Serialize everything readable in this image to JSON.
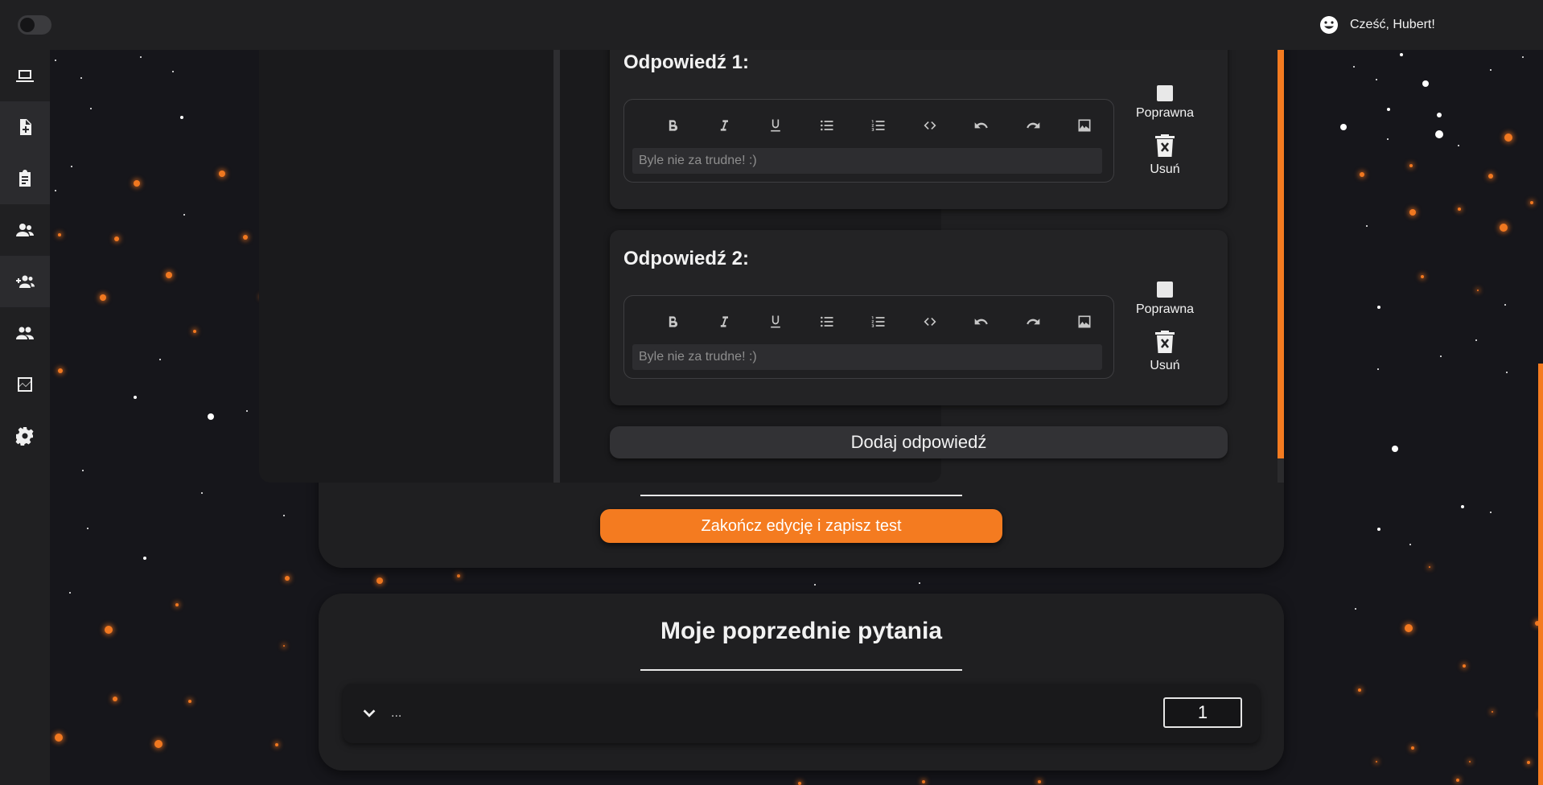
{
  "header": {
    "theme_toggle_icon": "toggle-switch",
    "user_icon": "smiley-face-icon",
    "greeting": "Cześć, Hubert!"
  },
  "sidebar": {
    "items": [
      {
        "icon": "laptop-icon"
      },
      {
        "icon": "add-document-icon"
      },
      {
        "icon": "clipboard-icon"
      },
      {
        "icon": "users-icon"
      },
      {
        "icon": "add-group-icon"
      },
      {
        "icon": "group-icon"
      },
      {
        "icon": "chart-icon"
      },
      {
        "icon": "gear-icon"
      }
    ]
  },
  "editor": {
    "answers": [
      {
        "title": "Odpowiedź 1:",
        "placeholder": "Byle nie za trudne! :)",
        "correct_label": "Poprawna",
        "delete_label": "Usuń",
        "correct": false
      },
      {
        "title": "Odpowiedź 2:",
        "placeholder": "Byle nie za trudne! :)",
        "correct_label": "Poprawna",
        "delete_label": "Usuń",
        "correct": false
      }
    ],
    "toolbar_icons": [
      "bold-icon",
      "italic-icon",
      "underline-icon",
      "bullet-list-icon",
      "numbered-list-icon",
      "code-icon",
      "undo-icon",
      "redo-icon",
      "image-icon"
    ],
    "add_answer_label": "Dodaj odpowiedź",
    "save_label": "Zakończ edycję i zapisz test"
  },
  "previous": {
    "title": "Moje poprzednie pytania",
    "row_text": "...",
    "page_value": "1"
  },
  "colors": {
    "accent": "#f47b20",
    "background": "#16161b",
    "panel": "#1f1f21",
    "card": "#232325"
  }
}
